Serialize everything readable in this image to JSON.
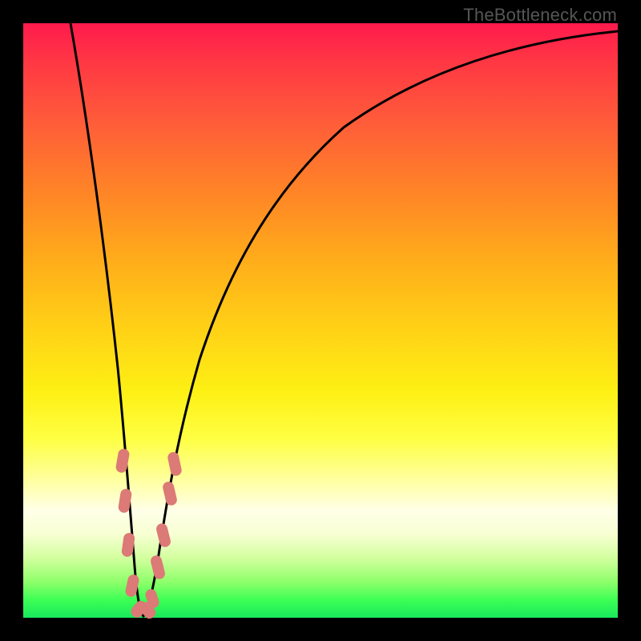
{
  "attribution": "TheBottleneck.com",
  "colors": {
    "frame": "#000000",
    "curve": "#000000",
    "bead": "#db7a76"
  },
  "chart_data": {
    "type": "line",
    "title": "",
    "xlabel": "",
    "ylabel": "",
    "xlim": [
      0,
      100
    ],
    "ylim": [
      0,
      100
    ],
    "grid": false,
    "legend": false,
    "note": "Axes are untitled in the source image; values are estimated in percent of plot-area. Background gradient encodes quality (red=bad top, green=good bottom). Black curve is a V/funnel shape with minimum near x≈20, y≈0.",
    "series": [
      {
        "name": "bottleneck-curve",
        "x": [
          8,
          10,
          12,
          14,
          16,
          18,
          19,
          20,
          21,
          22,
          24,
          26,
          30,
          36,
          44,
          54,
          66,
          80,
          92,
          100
        ],
        "y": [
          100,
          86,
          72,
          58,
          42,
          20,
          8,
          1,
          6,
          14,
          30,
          44,
          60,
          72,
          82,
          88,
          92,
          95,
          96.5,
          97
        ]
      }
    ],
    "highlighted_points": {
      "name": "bead-markers",
      "note": "Coral capsule-shaped markers clustered near the curve minimum, estimated positions (percent of plot-area, y measured from bottom).",
      "points": [
        {
          "x": 16.7,
          "y": 26.5
        },
        {
          "x": 17.0,
          "y": 19.5
        },
        {
          "x": 17.5,
          "y": 12.0
        },
        {
          "x": 18.2,
          "y": 5.2
        },
        {
          "x": 19.4,
          "y": 1.4
        },
        {
          "x": 20.6,
          "y": 1.2
        },
        {
          "x": 21.5,
          "y": 3.2
        },
        {
          "x": 22.6,
          "y": 8.5
        },
        {
          "x": 23.4,
          "y": 14.0
        },
        {
          "x": 24.4,
          "y": 21.0
        },
        {
          "x": 25.2,
          "y": 26.0
        }
      ]
    }
  }
}
